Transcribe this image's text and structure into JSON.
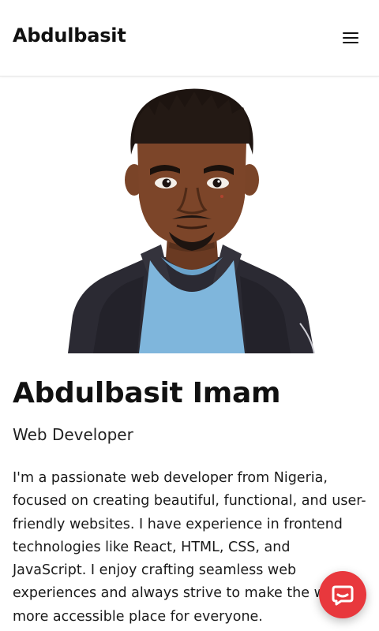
{
  "header": {
    "brand": "Abdulbasit",
    "menu_icon": "hamburger-menu-icon"
  },
  "hero": {
    "avatar_icon": "cartoon-avatar-portrait",
    "name": "Abdulbasit Imam",
    "role": "Web Developer",
    "bio": "I'm a passionate web developer from Nigeria, focused on creating beautiful, functional, and user-friendly websites. I have experience in frontend technologies like React, HTML, CSS, and JavaScript. I enjoy crafting seamless web experiences and always strive to make the web a more accessible place for everyone."
  },
  "chat_widget": {
    "icon": "chat-bubble-icon",
    "color": "#e8383d"
  }
}
